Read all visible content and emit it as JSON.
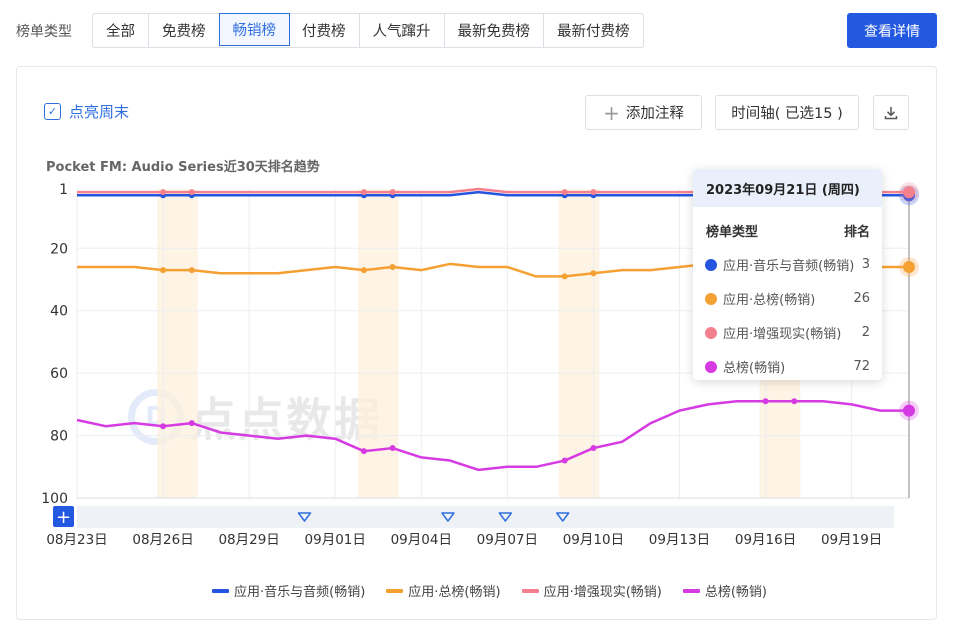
{
  "filter_bar": {
    "label": "榜单类型",
    "tabs": [
      "全部",
      "免费榜",
      "畅销榜",
      "付费榜",
      "人气蹿升",
      "最新免费榜",
      "最新付费榜"
    ],
    "active_tab": "畅销榜",
    "detail_button": "查看详情"
  },
  "toolbar": {
    "weekend_label": "点亮周末",
    "weekend_checked": true,
    "add_note": "添加注释",
    "timeline": "时间轴( 已选15 )",
    "download_icon": "download-icon"
  },
  "watermark": {
    "logo": "D",
    "text": "点点数据"
  },
  "tooltip": {
    "date": "2023年09月21日 (周四)",
    "col_type": "榜单类型",
    "col_rank": "排名",
    "rows": [
      {
        "name": "应用·音乐与音频(畅销)",
        "rank": "3",
        "color": "#2355e0"
      },
      {
        "name": "应用·总榜(畅销)",
        "rank": "26",
        "color": "#f5a033"
      },
      {
        "name": "应用·增强现实(畅销)",
        "rank": "2",
        "color": "#f4808e"
      },
      {
        "name": "总榜(畅销)",
        "rank": "72",
        "color": "#d63be3"
      }
    ]
  },
  "chart_data": {
    "type": "line",
    "title": "Pocket FM: Audio Series近30天排名趋势",
    "ylabel": "",
    "y_reversed": true,
    "ylim": [
      100,
      1
    ],
    "y_ticks": [
      "1",
      "20",
      "40",
      "60",
      "80",
      "100"
    ],
    "y_tick_values": [
      1,
      20,
      40,
      60,
      80,
      100
    ],
    "x_ticks": [
      "08月23日",
      "08月26日",
      "08月29日",
      "09月01日",
      "09月04日",
      "09月07日",
      "09月10日",
      "09月13日",
      "09月16日",
      "09月19日"
    ],
    "x_tick_index": [
      0,
      3,
      6,
      9,
      12,
      15,
      18,
      21,
      24,
      27
    ],
    "weekend_bands": [
      [
        3,
        4
      ],
      [
        10,
        11
      ],
      [
        17,
        18
      ],
      [
        24,
        25
      ]
    ],
    "annotation_markers_at": [
      8,
      13,
      15,
      17
    ],
    "grid": true,
    "legend_position": "bottom",
    "series": [
      {
        "name": "应用·音乐与音频(畅销)",
        "color": "#2355e0",
        "values": [
          3,
          3,
          3,
          3,
          3,
          3,
          3,
          3,
          3,
          3,
          3,
          3,
          3,
          3,
          2,
          3,
          3,
          3,
          3,
          3,
          3,
          3,
          3,
          3,
          3,
          3,
          3,
          3,
          3,
          3
        ]
      },
      {
        "name": "应用·总榜(畅销)",
        "color": "#f5a033",
        "values": [
          26,
          26,
          26,
          27,
          27,
          28,
          28,
          28,
          27,
          26,
          27,
          26,
          27,
          25,
          26,
          26,
          29,
          29,
          28,
          27,
          27,
          26,
          25,
          24,
          24,
          25,
          25,
          25,
          26,
          26
        ]
      },
      {
        "name": "应用·增强现实(畅销)",
        "color": "#f4808e",
        "values": [
          2,
          2,
          2,
          2,
          2,
          2,
          2,
          2,
          2,
          2,
          2,
          2,
          2,
          2,
          1,
          2,
          2,
          2,
          2,
          2,
          2,
          2,
          2,
          2,
          2,
          2,
          2,
          2,
          2,
          2
        ]
      },
      {
        "name": "总榜(畅销)",
        "color": "#d63be3",
        "values": [
          75,
          77,
          76,
          77,
          76,
          79,
          80,
          81,
          80,
          81,
          85,
          84,
          87,
          88,
          91,
          90,
          90,
          88,
          84,
          82,
          76,
          72,
          70,
          69,
          69,
          69,
          69,
          70,
          72,
          72
        ]
      }
    ]
  }
}
